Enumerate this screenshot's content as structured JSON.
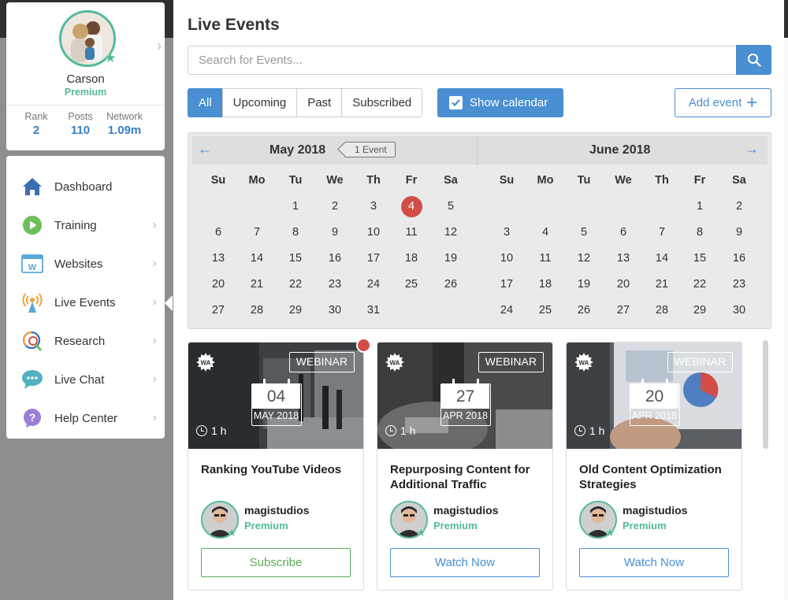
{
  "profile": {
    "name": "Carson",
    "tier": "Premium",
    "stats": [
      {
        "label": "Rank",
        "value": "2"
      },
      {
        "label": "Posts",
        "value": "110"
      },
      {
        "label": "Network",
        "value": "1.09m"
      }
    ]
  },
  "nav": {
    "items": [
      {
        "label": "Dashboard",
        "icon": "home-icon"
      },
      {
        "label": "Training",
        "icon": "play-icon"
      },
      {
        "label": "Websites",
        "icon": "website-icon"
      },
      {
        "label": "Live Events",
        "icon": "broadcast-icon"
      },
      {
        "label": "Research",
        "icon": "research-icon"
      },
      {
        "label": "Live Chat",
        "icon": "chat-icon"
      },
      {
        "label": "Help Center",
        "icon": "help-icon"
      }
    ]
  },
  "main": {
    "title": "Live Events",
    "search_placeholder": "Search for Events...",
    "filters": [
      "All",
      "Upcoming",
      "Past",
      "Subscribed"
    ],
    "active_filter": "All",
    "show_calendar_label": "Show calendar",
    "add_event_label": "Add event"
  },
  "calendar": {
    "weekdays": [
      "Su",
      "Mo",
      "Tu",
      "We",
      "Th",
      "Fr",
      "Sa"
    ],
    "months": [
      {
        "title": "May 2018",
        "first_weekday": 2,
        "days": 31,
        "event_tag": "1 Event",
        "highlighted_day": 4
      },
      {
        "title": "June 2018",
        "first_weekday": 5,
        "days": 30
      }
    ]
  },
  "events": [
    {
      "badge": "WEBINAR",
      "day": "04",
      "month": "MAY 2018",
      "duration": "1 h",
      "title": "Ranking YouTube Videos",
      "host": "magistudios",
      "host_tier": "Premium",
      "button": "Subscribe",
      "button_style": "subscribe",
      "notification": true
    },
    {
      "badge": "WEBINAR",
      "day": "27",
      "month": "APR 2018",
      "duration": "1 h",
      "title": "Repurposing Content for Additional Traffic",
      "host": "magistudios",
      "host_tier": "Premium",
      "button": "Watch Now",
      "button_style": "watch",
      "notification": false
    },
    {
      "badge": "WEBINAR",
      "day": "20",
      "month": "APR 2018",
      "duration": "1 h",
      "title": "Old Content Optimization Strategies",
      "host": "magistudios",
      "host_tier": "Premium",
      "button": "Watch Now",
      "button_style": "watch",
      "notification": false
    }
  ],
  "colors": {
    "accent": "#4a8fd1",
    "premium": "#53b99b",
    "highlight": "#d24d48",
    "subscribe": "#5aab58"
  }
}
